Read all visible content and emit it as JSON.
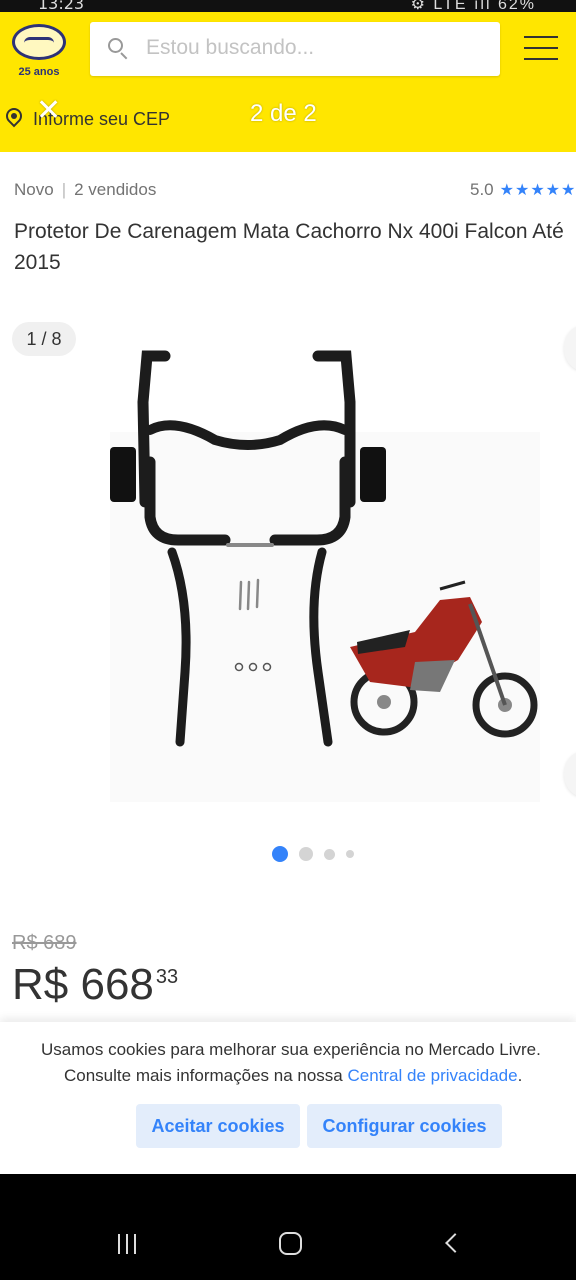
{
  "status": {
    "time": "13:23",
    "right": "⚙ LTE ıll 62%"
  },
  "header": {
    "logo_text": "25 anos",
    "search_placeholder": "Estou buscando...",
    "cep_label": "Informe seu CEP",
    "overlay_close": "✕",
    "overlay_counter": "2 de 2"
  },
  "product": {
    "condition": "Novo",
    "sold": "2 vendidos",
    "rating": "5.0",
    "stars": "★★★★★",
    "title": "Protetor De Carenagem Mata Cachorro Nx 400i Falcon Até 2015",
    "image_counter": "1 / 8",
    "old_price": "R$ 689",
    "price_main": "R$ 668",
    "price_cents": "33",
    "carousel_active_index": 1,
    "carousel_dots_visible": 4
  },
  "cookies": {
    "line1": "Usamos cookies para melhorar sua experiência no Mercado Livre.",
    "line2_prefix": "Consulte mais informações na nossa ",
    "line2_link": "Central de privacidade",
    "line2_suffix": ".",
    "accept_label": "Aceitar cookies",
    "config_label": "Configurar cookies"
  },
  "colors": {
    "brand_yellow": "#ffe600",
    "accent_blue": "#3483fa",
    "button_bg": "#e3edfb"
  }
}
